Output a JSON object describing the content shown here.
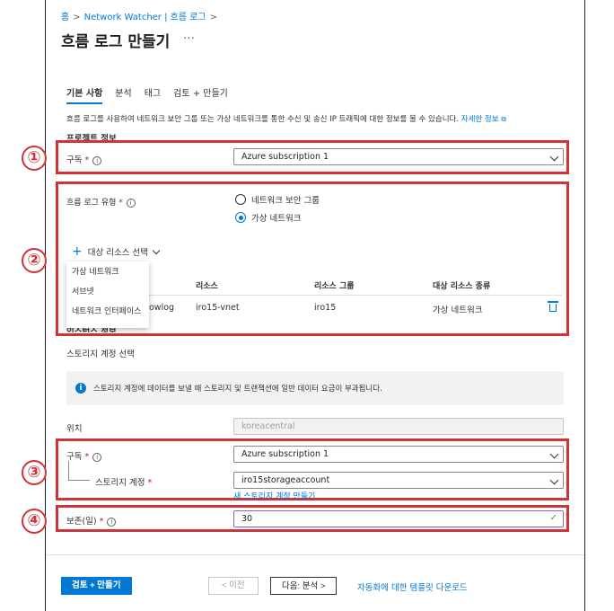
{
  "breadcrumb": {
    "home": "홈",
    "watcher": "Network Watcher | 흐름 로그",
    "sep": ">"
  },
  "page": {
    "title": "흐름 로그 만들기",
    "more": "…"
  },
  "tabs": [
    {
      "label": "기본 사항",
      "active": true
    },
    {
      "label": "분석"
    },
    {
      "label": "태그"
    },
    {
      "label": "검토 + 만들기"
    }
  ],
  "description": {
    "text": "흐름 로그를 사용하여 네트워크 보안 그룹 또는 가상 네트워크를 통한 수신 및 송신 IP 트래픽에 대한 정보를 볼 수 있습니다.",
    "link": "자세한 정보"
  },
  "project": {
    "section_title": "프로젝트 정보",
    "subscription_label": "구독",
    "subscription_value": "Azure subscription 1"
  },
  "flow_type": {
    "label": "흐름 로그 유형",
    "options": [
      "네트워크 보안 그룹",
      "가상 네트워크"
    ],
    "selected": "가상 네트워크"
  },
  "target": {
    "add_label": "대상 리소스 선택",
    "menu_items": [
      "가상 네트워크",
      "서브넷",
      "네트워크 인터페이스"
    ],
    "columns": [
      "리소스",
      "리소스 그룹",
      "대상 리소스 종류"
    ],
    "row": {
      "name_partial": "owlog",
      "resource": "iro15-vnet",
      "group": "iro15",
      "type": "가상 네트워크"
    },
    "hidden_heading_partial": "인스턴스 정보"
  },
  "storage": {
    "section_title": "스토리지 계정 선택",
    "info_text": "스토리지 계정에 데이터를 보낼 때 스토리지 및 트랜잭션에 일반 데이터 요금이 부과됩니다.",
    "location_label": "위치",
    "location_value": "koreacentral",
    "subscription_label": "구독",
    "subscription_value": "Azure subscription 1",
    "account_label": "스토리지 계정",
    "account_value": "iro15storageaccount",
    "new_link": "새 스토리지 계정 만들기"
  },
  "retention": {
    "label": "보존(일)",
    "value": "30"
  },
  "markers": [
    "①",
    "②",
    "③",
    "④"
  ],
  "footer": {
    "review_create": "검토 + 만들기",
    "prev": "< 이전",
    "next": "다음: 분석 >",
    "download": "자동화에 대한 템플릿 다운로드"
  },
  "colors": {
    "accent": "#0078d4",
    "highlight": "#d13438",
    "required": "#a4262c"
  }
}
